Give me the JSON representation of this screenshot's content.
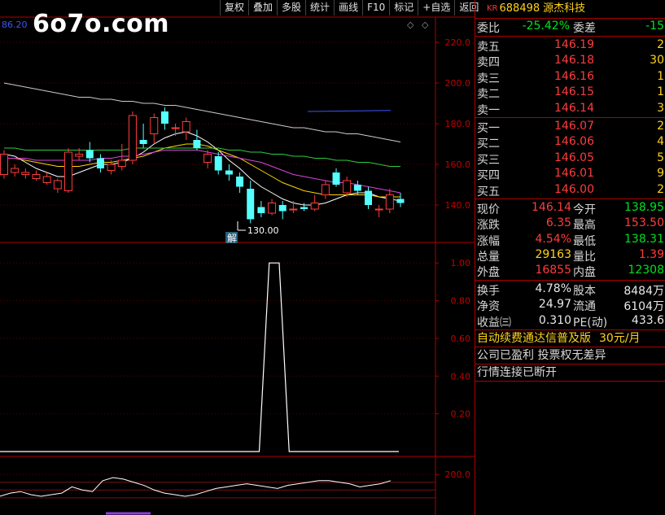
{
  "watermark": "6o7o.com",
  "corner_value": "86.20",
  "toolbar": [
    "复权",
    "叠加",
    "多股",
    "统计",
    "画线",
    "F10",
    "标记",
    "+自选",
    "返回"
  ],
  "icons": {
    "settings": "diamond-icon",
    "close": "diamond-icon"
  },
  "stock": {
    "market": "KR",
    "code": "688498",
    "name": "源杰科技"
  },
  "quote": {
    "weibi_label": "委比",
    "weibi": "-25.42%",
    "weicha_label": "委差",
    "weicha": "-15",
    "asks": [
      {
        "label": "卖五",
        "price": "146.19",
        "vol": "2"
      },
      {
        "label": "卖四",
        "price": "146.18",
        "vol": "30"
      },
      {
        "label": "卖三",
        "price": "146.16",
        "vol": "1"
      },
      {
        "label": "卖二",
        "price": "146.15",
        "vol": "1"
      },
      {
        "label": "卖一",
        "price": "146.14",
        "vol": "3"
      }
    ],
    "bids": [
      {
        "label": "买一",
        "price": "146.07",
        "vol": "2"
      },
      {
        "label": "买二",
        "price": "146.06",
        "vol": "4"
      },
      {
        "label": "买三",
        "price": "146.05",
        "vol": "5"
      },
      {
        "label": "买四",
        "price": "146.01",
        "vol": "9"
      },
      {
        "label": "买五",
        "price": "146.00",
        "vol": "2"
      }
    ],
    "stats1": [
      {
        "l1": "现价",
        "v1": "146.14",
        "c1": "red",
        "l2": "今开",
        "v2": "138.95",
        "c2": "green"
      },
      {
        "l1": "涨跌",
        "v1": "6.35",
        "c1": "red",
        "l2": "最高",
        "v2": "153.50",
        "c2": "red"
      },
      {
        "l1": "涨幅",
        "v1": "4.54%",
        "c1": "red",
        "l2": "最低",
        "v2": "138.31",
        "c2": "green"
      },
      {
        "l1": "总量",
        "v1": "29163",
        "c1": "yellow",
        "l2": "量比",
        "v2": "1.39",
        "c2": "red"
      },
      {
        "l1": "外盘",
        "v1": "16855",
        "c1": "red",
        "l2": "内盘",
        "v2": "12308",
        "c2": "green"
      }
    ],
    "stats2": [
      {
        "l1": "换手",
        "v1": "4.78%",
        "c1": "white",
        "l2": "股本",
        "v2": "8484万",
        "c2": "white"
      },
      {
        "l1": "净资",
        "v1": "24.97",
        "c1": "white",
        "l2": "流通",
        "v2": "6104万",
        "c2": "white"
      },
      {
        "l1": "收益㈢",
        "v1": "0.310",
        "c1": "white",
        "l2": "PE(动)",
        "v2": "433.6",
        "c2": "white"
      }
    ]
  },
  "ad": {
    "main": "自动续费通达信普及版",
    "price": "30元/月"
  },
  "messages": [
    "公司已盈利 投票权无差异",
    "行情连接已断开"
  ],
  "chart": {
    "price_axis": [
      "220.0",
      "200.0",
      "180.0",
      "160.0",
      "140.0"
    ],
    "low_marker": "130.00",
    "event_tag": "解",
    "indicator_axis": [
      "1.00",
      "0.80",
      "0.60",
      "0.40",
      "0.20"
    ],
    "bottom_axis": [
      "200.0"
    ]
  },
  "chart_data": {
    "type": "candlestick",
    "price_ylim": [
      122,
      232
    ],
    "candles": [
      [
        155,
        165,
        153,
        167
      ],
      [
        156,
        158,
        154,
        160
      ],
      [
        155,
        156,
        153,
        158
      ],
      [
        153,
        155,
        152,
        157
      ],
      [
        151,
        154,
        150,
        156
      ],
      [
        148,
        152,
        146,
        153
      ],
      [
        147,
        166,
        146,
        168
      ],
      [
        164,
        165,
        162,
        168
      ],
      [
        167,
        163,
        161,
        171
      ],
      [
        163,
        158,
        156,
        165
      ],
      [
        157,
        160,
        155,
        162
      ],
      [
        159,
        162,
        157,
        170
      ],
      [
        162,
        184,
        160,
        186
      ],
      [
        172,
        170,
        168,
        180
      ],
      [
        175,
        183,
        170,
        185
      ],
      [
        186,
        180,
        177,
        188
      ],
      [
        178,
        178,
        174,
        180
      ],
      [
        176,
        181,
        172,
        183
      ],
      [
        172,
        168,
        167,
        177
      ],
      [
        161,
        165,
        158,
        167
      ],
      [
        164,
        157,
        155,
        166
      ],
      [
        157,
        155,
        152,
        160
      ],
      [
        154,
        149,
        146,
        156
      ],
      [
        148,
        133,
        131,
        152
      ],
      [
        139,
        136,
        134,
        142
      ],
      [
        136,
        141,
        135,
        143
      ],
      [
        140,
        137,
        133,
        142
      ],
      [
        138,
        138,
        136,
        142
      ],
      [
        139,
        138,
        137,
        141
      ],
      [
        138,
        141,
        137,
        145
      ],
      [
        145,
        150,
        143,
        152
      ],
      [
        156,
        150,
        149,
        158
      ],
      [
        146,
        152,
        144,
        154
      ],
      [
        150,
        147,
        145,
        152
      ],
      [
        147,
        140,
        138,
        149
      ],
      [
        138,
        138,
        134,
        140
      ],
      [
        138,
        145,
        136,
        148
      ],
      [
        143,
        141,
        139,
        146
      ]
    ],
    "ma_series": [
      {
        "color": "#ffffff",
        "values": [
          165,
          164,
          161,
          158,
          156,
          154,
          154,
          156,
          158,
          160,
          160,
          161,
          163,
          166,
          170,
          173,
          175,
          176,
          174,
          171,
          167,
          162,
          158,
          153,
          149,
          146,
          143,
          141,
          140,
          140,
          141,
          143,
          145,
          146,
          146,
          144,
          143,
          142
        ]
      },
      {
        "color": "#ffd700",
        "values": [
          163,
          163,
          162,
          161,
          160,
          159,
          159,
          159,
          160,
          161,
          161,
          162,
          163,
          164,
          166,
          168,
          169,
          170,
          170,
          169,
          167,
          165,
          163,
          160,
          157,
          154,
          151,
          149,
          147,
          146,
          145,
          145,
          145,
          145,
          145,
          144,
          144,
          144
        ]
      },
      {
        "color": "#dd44dd",
        "values": [
          163,
          163,
          163,
          162,
          162,
          162,
          162,
          162,
          162,
          163,
          163,
          164,
          164,
          165,
          166,
          167,
          167,
          167,
          167,
          166,
          165,
          164,
          163,
          162,
          161,
          159,
          157,
          155,
          154,
          153,
          152,
          151,
          151,
          150,
          149,
          148,
          147,
          146
        ]
      },
      {
        "color": "#2ecc40",
        "values": [
          168,
          168,
          167,
          167,
          167,
          167,
          167,
          167,
          167,
          167,
          167,
          167,
          168,
          168,
          168,
          168,
          168,
          168,
          168,
          168,
          168,
          167,
          167,
          166,
          166,
          165,
          165,
          164,
          164,
          163,
          163,
          162,
          162,
          161,
          161,
          160,
          159,
          159
        ]
      },
      {
        "color": "#cccccc",
        "values": [
          200,
          199,
          198,
          197,
          196,
          195,
          194,
          193,
          193,
          192,
          192,
          191,
          191,
          190,
          190,
          189,
          189,
          188,
          187,
          186,
          185,
          184,
          183,
          182,
          181,
          180,
          179,
          178,
          178,
          177,
          176,
          176,
          175,
          175,
          174,
          173,
          172,
          171
        ]
      }
    ],
    "indicator": {
      "ylim": [
        0,
        1.1
      ],
      "values": [
        0,
        0,
        0,
        0,
        0,
        0,
        0,
        0,
        0,
        0,
        0,
        0,
        0,
        0,
        0,
        0,
        0,
        0,
        0,
        0,
        0,
        0,
        0,
        0,
        0,
        0,
        0,
        1,
        1,
        0,
        0,
        0,
        0,
        0,
        0,
        0,
        0,
        0,
        0,
        0,
        0
      ]
    },
    "bottom_line": [
      186,
      188,
      189,
      187,
      186,
      187,
      188,
      192,
      190,
      189,
      196,
      198,
      197,
      195,
      193,
      190,
      188,
      187,
      186,
      187,
      189,
      191,
      192,
      193,
      194,
      193,
      192,
      191,
      193,
      194,
      195,
      196,
      196,
      195,
      194,
      192,
      193,
      194,
      196
    ]
  }
}
